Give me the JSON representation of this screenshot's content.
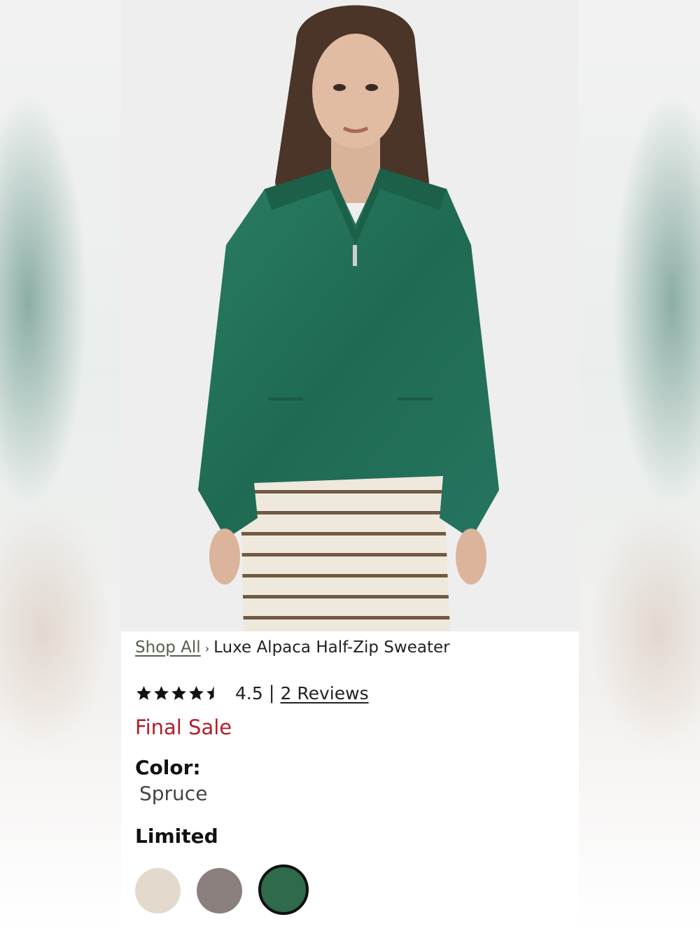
{
  "breadcrumb": {
    "parent": "Shop All",
    "separator": "›",
    "current": "Luxe Alpaca Half-Zip Sweater"
  },
  "rating": {
    "value": "4.5",
    "stars": 4.5,
    "max_stars": 5,
    "divider": "|",
    "reviews_label": "2 Reviews"
  },
  "status": {
    "final_sale": "Final Sale"
  },
  "color": {
    "label": "Color:",
    "selected": "Spruce"
  },
  "availability": {
    "label": "Limited"
  },
  "swatches": [
    {
      "color": "#e3d9cc",
      "selected": false
    },
    {
      "color": "#8a7f7d",
      "selected": false
    },
    {
      "color": "#2f6a4a",
      "selected": true
    }
  ],
  "colors": {
    "sale_red": "#b0202a",
    "breadcrumb_link": "#55604a",
    "sweater_green": "#22705a"
  }
}
